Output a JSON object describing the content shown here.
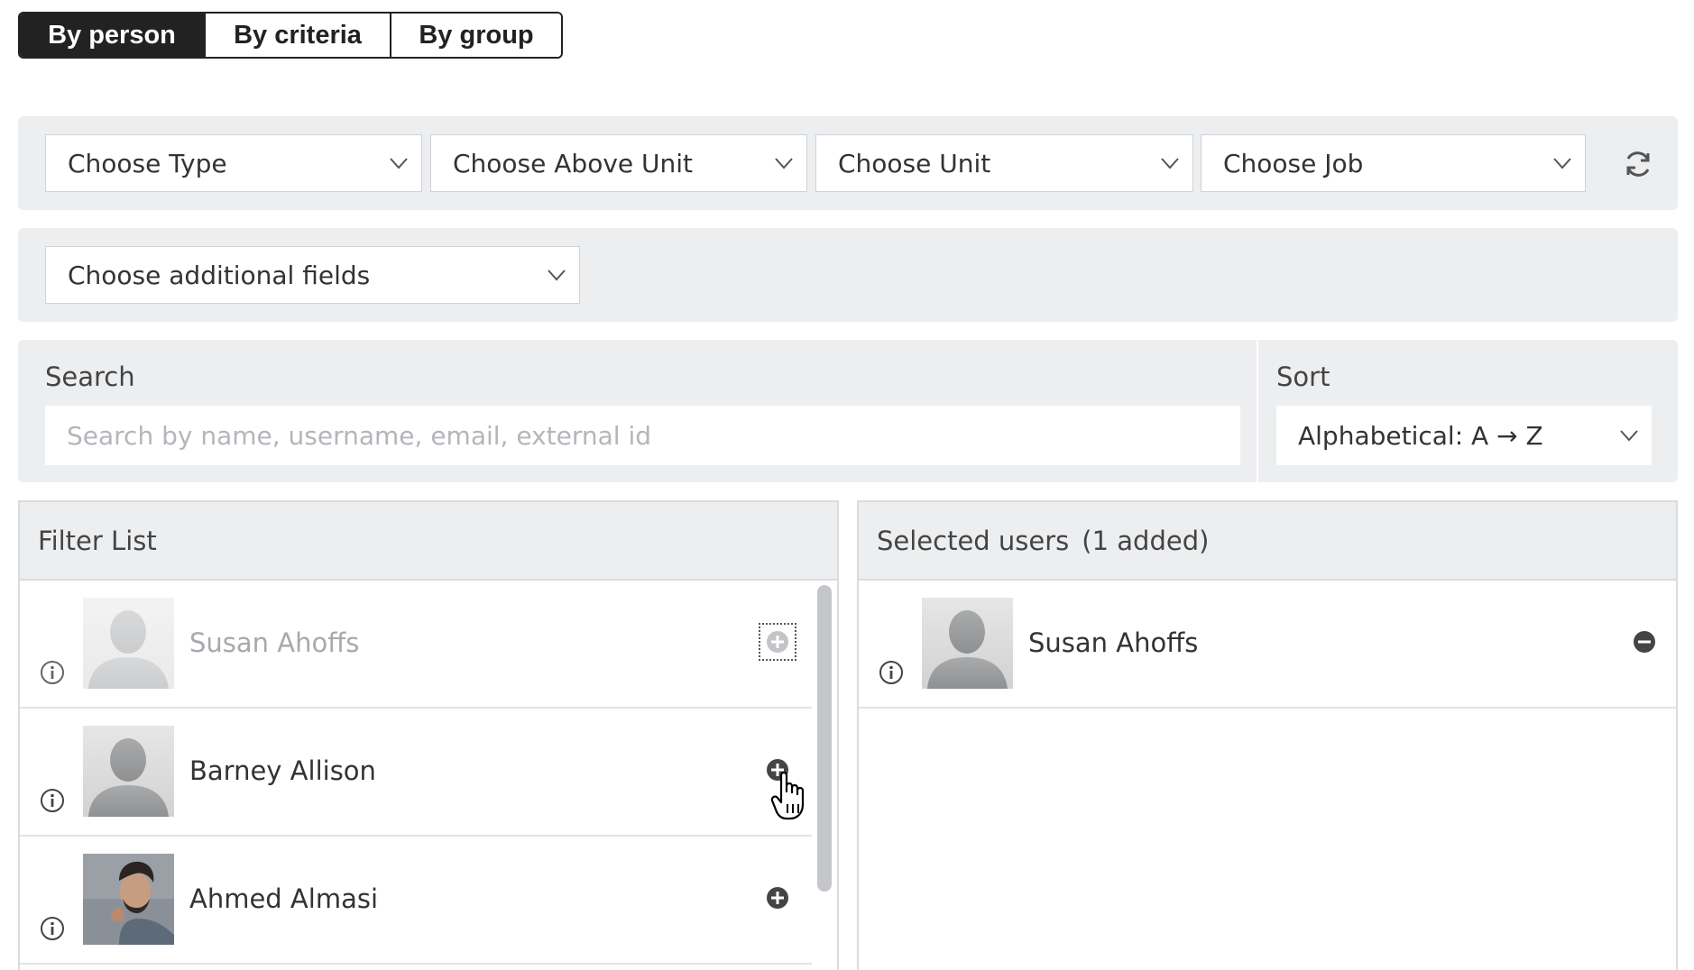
{
  "tabs": [
    {
      "label": "By person",
      "active": true
    },
    {
      "label": "By criteria",
      "active": false
    },
    {
      "label": "By group",
      "active": false
    }
  ],
  "filters": {
    "type": "Choose Type",
    "above_unit": "Choose Above Unit",
    "unit": "Choose Unit",
    "job": "Choose Job",
    "refresh_icon": "refresh-icon",
    "additional_fields": "Choose additional fields"
  },
  "search": {
    "label": "Search",
    "placeholder": "Search by name, username, email, external id",
    "value": ""
  },
  "sort": {
    "label": "Sort",
    "value": "Alphabetical: A → Z"
  },
  "filter_list": {
    "title": "Filter List",
    "rows": [
      {
        "name": "Susan Ahoffs",
        "avatar": "default-avatar",
        "state": "added"
      },
      {
        "name": "Barney Allison",
        "avatar": "default-avatar",
        "state": "available"
      },
      {
        "name": "Ahmed Almasi",
        "avatar": "photo",
        "state": "available"
      }
    ]
  },
  "selected_users": {
    "title": "Selected users",
    "count_text": "(1 added)",
    "rows": [
      {
        "name": "Susan Ahoffs",
        "avatar": "default-avatar"
      }
    ]
  },
  "colors": {
    "accent": "#222222",
    "panel": "#edeef0",
    "border": "#d9dbde",
    "muted_text": "#a6a9ad"
  }
}
